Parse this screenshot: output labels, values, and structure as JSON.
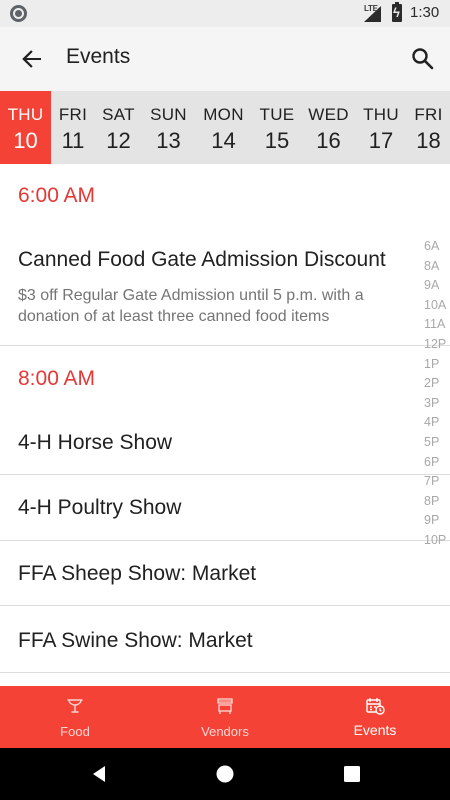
{
  "status_bar": {
    "network_label": "LTE",
    "time": "1:30",
    "icons": [
      "notification-circle-icon",
      "signal-icon",
      "battery-charging-icon"
    ]
  },
  "app_bar": {
    "title": "Events",
    "icons": [
      "back-arrow-icon",
      "search-icon"
    ]
  },
  "days": [
    {
      "name": "THU",
      "number": "10",
      "selected": true
    },
    {
      "name": "FRI",
      "number": "11",
      "selected": false
    },
    {
      "name": "SAT",
      "number": "12",
      "selected": false
    },
    {
      "name": "SUN",
      "number": "13",
      "selected": false
    },
    {
      "name": "MON",
      "number": "14",
      "selected": false
    },
    {
      "name": "TUE",
      "number": "15",
      "selected": false
    },
    {
      "name": "WED",
      "number": "16",
      "selected": false
    },
    {
      "name": "THU",
      "number": "17",
      "selected": false
    },
    {
      "name": "FRI",
      "number": "18",
      "selected": false
    }
  ],
  "events": {
    "groups": [
      {
        "time": "6:00 AM",
        "items": [
          {
            "title": "Canned Food Gate Admission Discount",
            "description": "$3 off Regular Gate Admission until 5 p.m. with a donation of at least three canned food items"
          }
        ]
      },
      {
        "time": "8:00 AM",
        "items": [
          {
            "title": "4-H Horse Show"
          },
          {
            "title": "4-H Poultry Show"
          },
          {
            "title": "FFA Sheep Show: Market"
          },
          {
            "title": "FFA Swine Show: Market"
          }
        ]
      }
    ],
    "hour_index": [
      "6A",
      "8A",
      "9A",
      "10A",
      "11A",
      "12P",
      "1P",
      "2P",
      "3P",
      "4P",
      "5P",
      "6P",
      "7P",
      "8P",
      "9P",
      "10P"
    ]
  },
  "bottom_nav": {
    "items": [
      {
        "label": "Food",
        "icon": "food-icon",
        "active": false
      },
      {
        "label": "Vendors",
        "icon": "vendor-stand-icon",
        "active": false
      },
      {
        "label": "Events",
        "icon": "calendar-events-icon",
        "active": true
      }
    ],
    "accent_color": "#f44336"
  },
  "system_nav": {
    "icons": [
      "back-triangle-icon",
      "home-circle-icon",
      "recents-square-icon"
    ]
  },
  "colors": {
    "accent": "#f44336",
    "time_header": "#e53935",
    "day_strip_bg": "#e4e4e4",
    "app_bar_bg": "#f5f5f5"
  }
}
